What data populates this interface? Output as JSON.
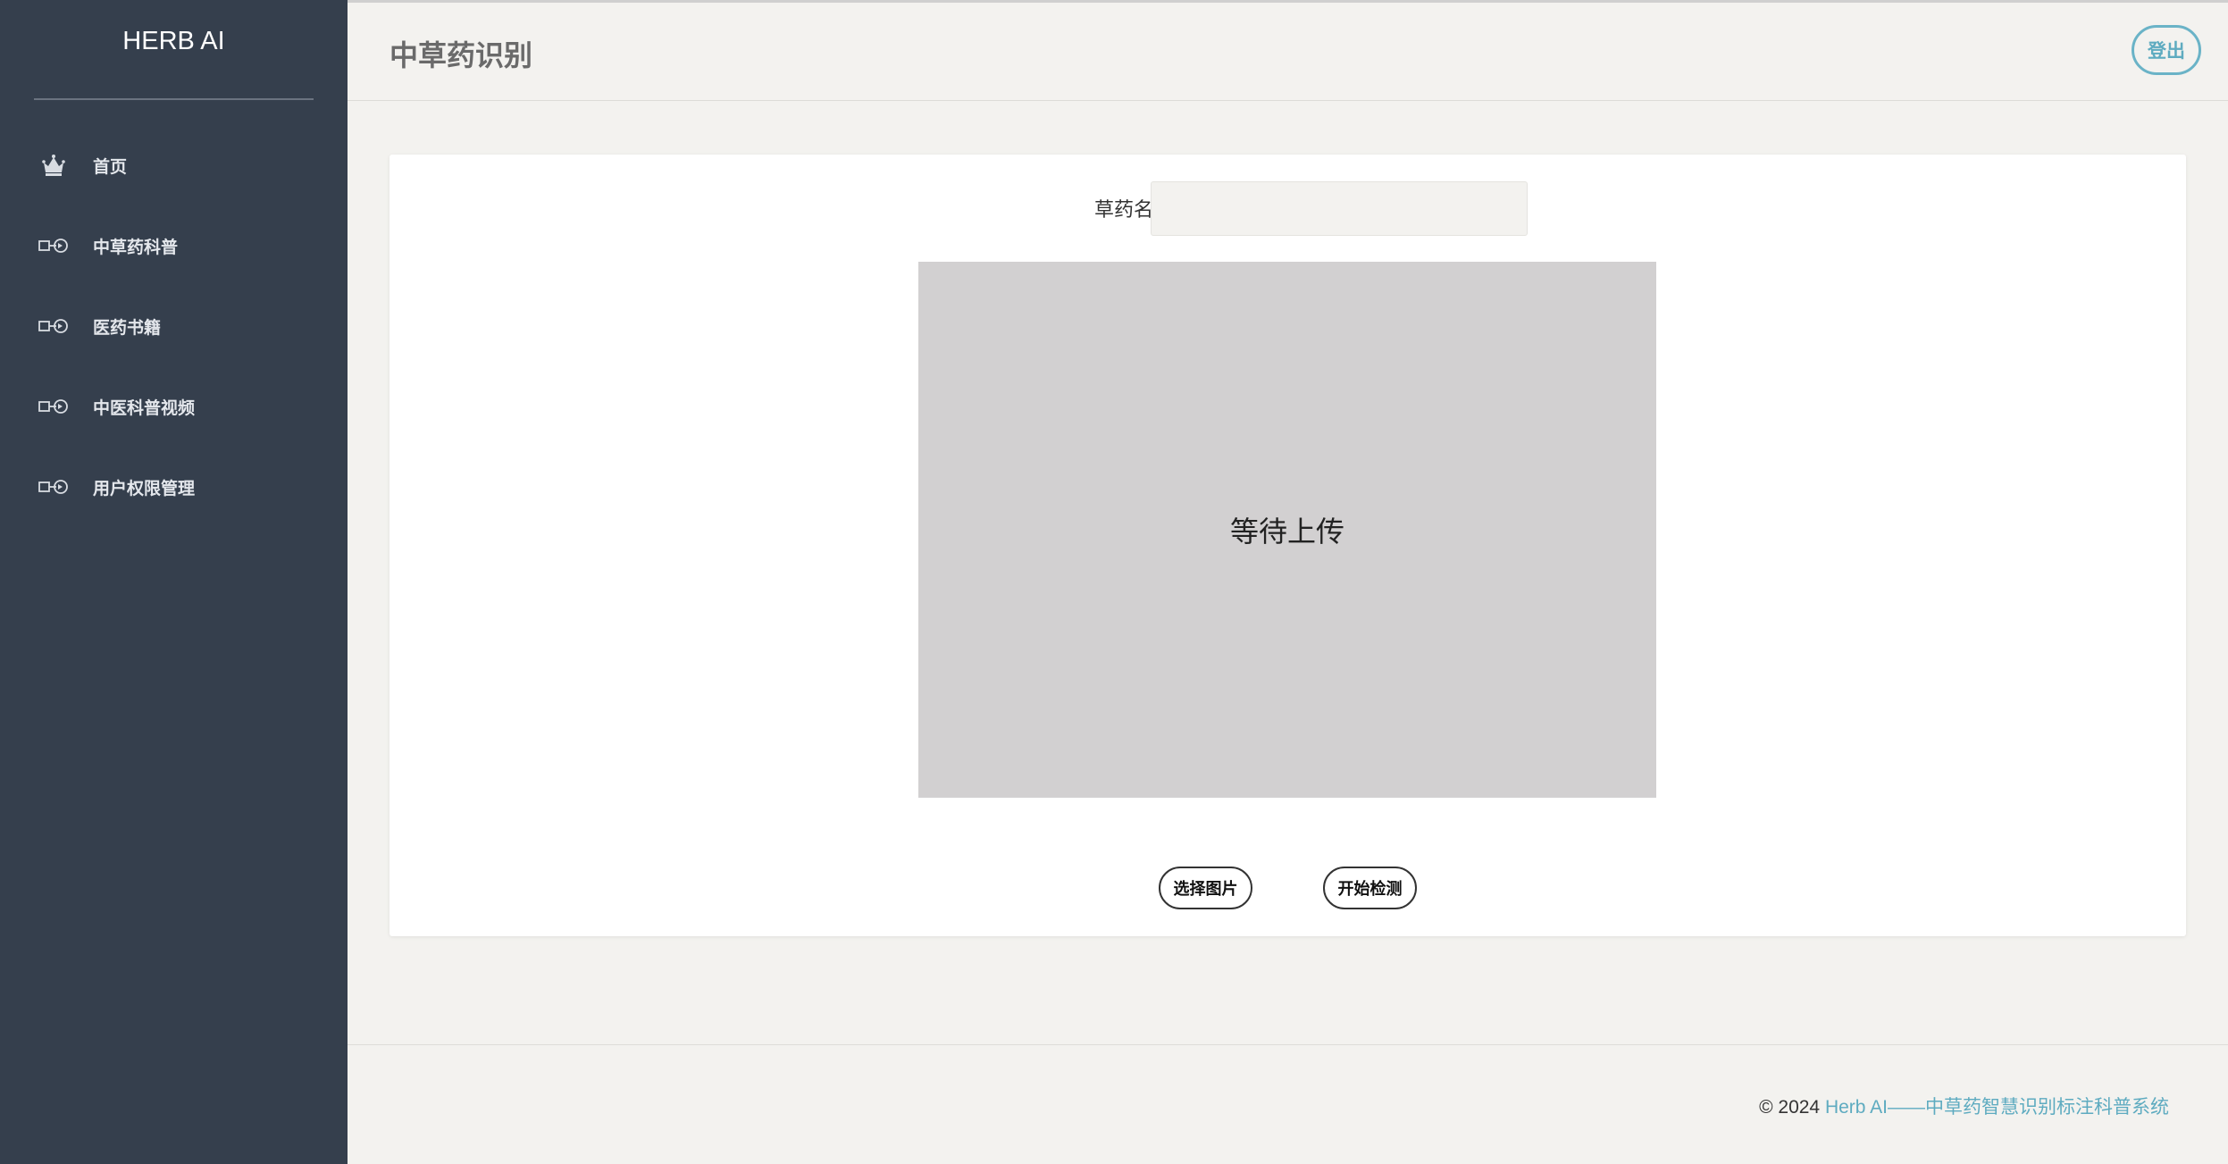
{
  "sidebar": {
    "brand": "HERB AI",
    "items": [
      {
        "label": "首页",
        "icon": "crown-icon"
      },
      {
        "label": "中草药科普",
        "icon": "arrow-circle-icon"
      },
      {
        "label": "医药书籍",
        "icon": "arrow-circle-icon"
      },
      {
        "label": "中医科普视频",
        "icon": "arrow-circle-icon"
      },
      {
        "label": "用户权限管理",
        "icon": "arrow-circle-icon"
      }
    ]
  },
  "header": {
    "title": "中草药识别",
    "logout_label": "登出"
  },
  "form": {
    "name_label": "草药名称",
    "name_value": "",
    "upload_placeholder": "等待上传",
    "select_image_label": "选择图片",
    "start_detect_label": "开始检测"
  },
  "footer": {
    "copyright": "© 2024",
    "link_text": "Herb AI——中草药智慧识别标注科普系统"
  },
  "colors": {
    "sidebar_bg": "#353f4d",
    "accent": "#5eabc0",
    "page_bg": "#f3f2ef",
    "upload_bg": "#d2d0d1"
  }
}
